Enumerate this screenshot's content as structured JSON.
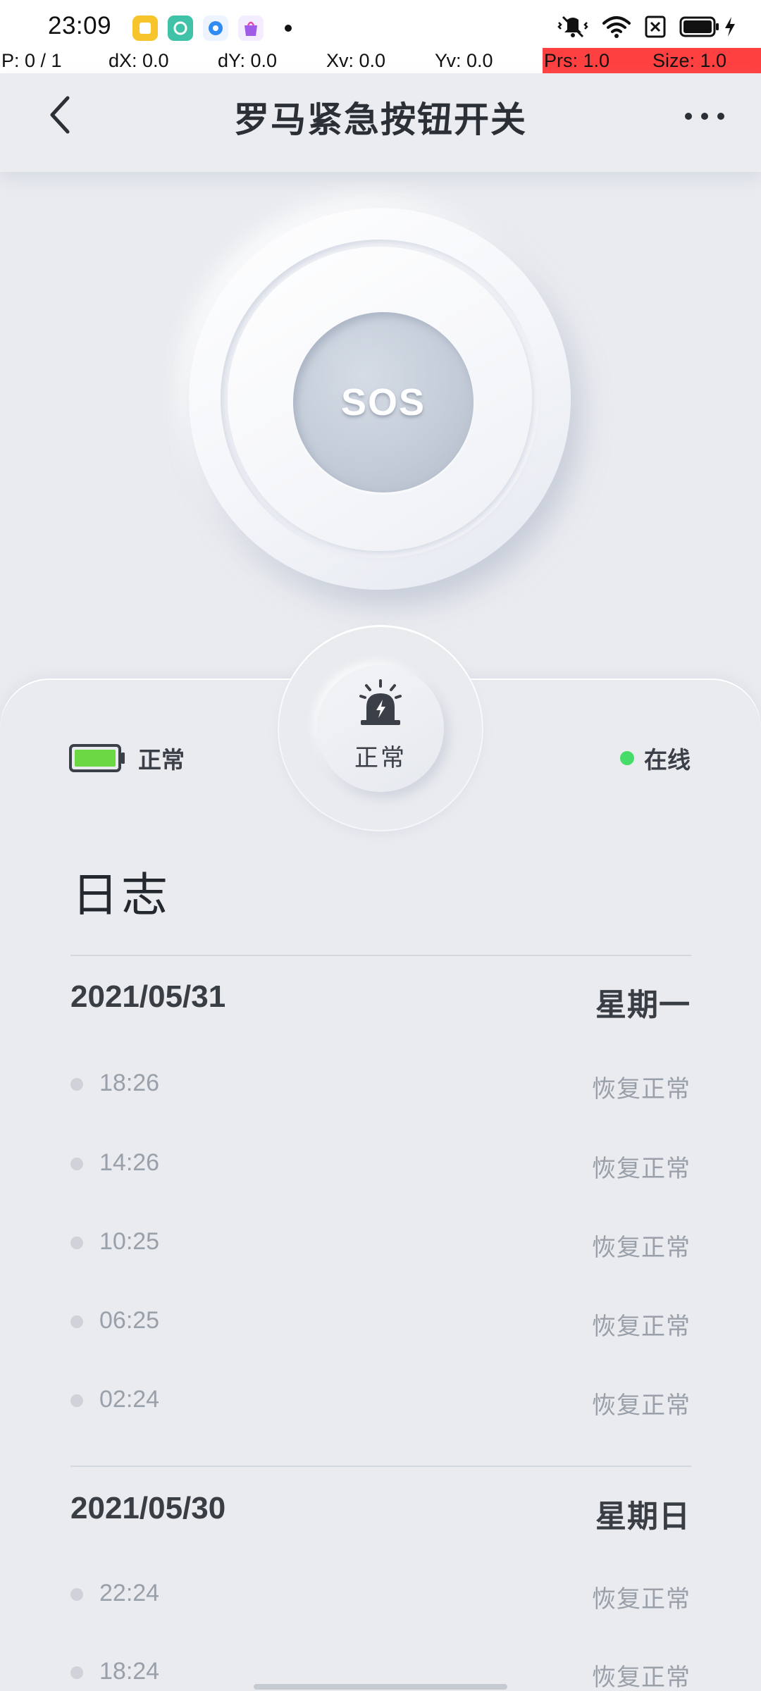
{
  "status_bar": {
    "time": "23:09",
    "notification_icons": [
      {
        "name": "notes-app-icon",
        "color": "#f7c52b"
      },
      {
        "name": "camera-app-icon",
        "color": "#3fc2a7"
      },
      {
        "name": "browser-app-icon",
        "color": "#2f8cf0"
      },
      {
        "name": "shopping-app-icon",
        "color": "#a05ce6"
      }
    ],
    "system_icons": [
      "mute-vibrate-icon",
      "wifi-icon",
      "sim-off-icon",
      "battery-icon",
      "charging-icon"
    ]
  },
  "debug": {
    "pointer": "P: 0 / 1",
    "dx": "dX: 0.0",
    "dy": "dY: 0.0",
    "xv": "Xv: 0.0",
    "yv": "Yv: 0.0",
    "prs": "Prs: 1.0",
    "size": "Size: 1.0",
    "highlight_color": "#ff4040"
  },
  "header": {
    "title": "罗马紧急按钮开关",
    "back_icon": "chevron-left-icon",
    "more_icon": "more-horizontal-icon"
  },
  "sos_button": {
    "label": "SOS"
  },
  "device_status": {
    "battery": {
      "label": "正常",
      "level": 1.0,
      "fill_color": "#6bd943"
    },
    "alarm": {
      "label": "正常",
      "icon": "alarm-light-icon"
    },
    "connection": {
      "label": "在线",
      "dot_color": "#45dd67"
    }
  },
  "log": {
    "title": "日志",
    "days": [
      {
        "date": "2021/05/31",
        "weekday": "星期一",
        "entries": [
          {
            "time": "18:26",
            "status": "恢复正常"
          },
          {
            "time": "14:26",
            "status": "恢复正常"
          },
          {
            "time": "10:25",
            "status": "恢复正常"
          },
          {
            "time": "06:25",
            "status": "恢复正常"
          },
          {
            "time": "02:24",
            "status": "恢复正常"
          }
        ]
      },
      {
        "date": "2021/05/30",
        "weekday": "星期日",
        "entries": [
          {
            "time": "22:24",
            "status": "恢复正常"
          },
          {
            "time": "18:24",
            "status": "恢复正常"
          }
        ]
      }
    ]
  }
}
